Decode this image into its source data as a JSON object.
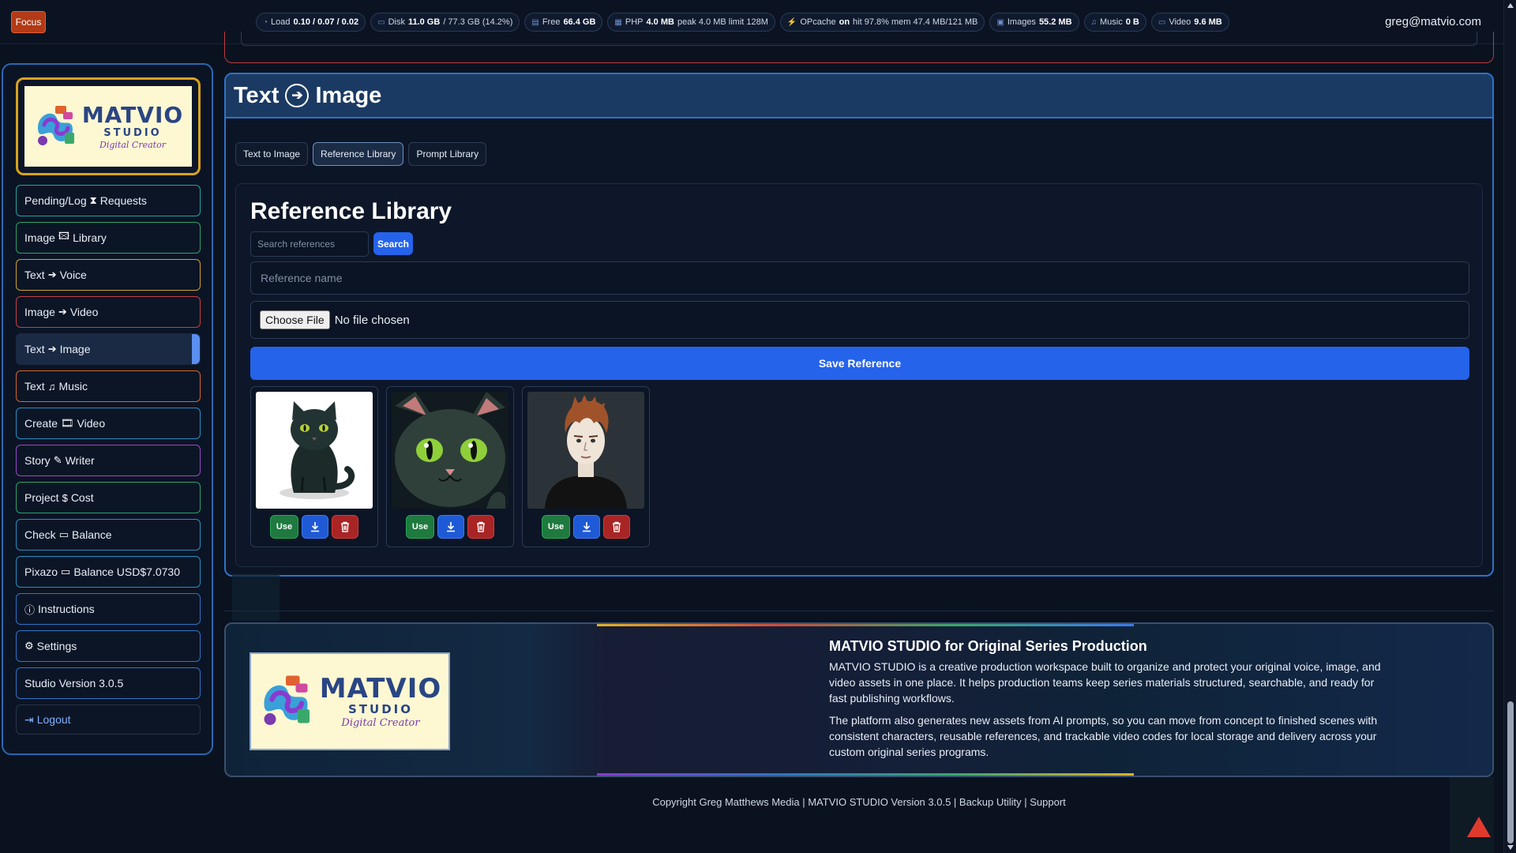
{
  "topbar": {
    "focus_label": "Focus",
    "stats": [
      {
        "icon": "gauge-icon",
        "label": "Load",
        "value": "0.10 / 0.07 / 0.02",
        "suffix": ""
      },
      {
        "icon": "disk-icon",
        "label": "Disk",
        "value": "11.0 GB",
        "suffix": "/ 77.3 GB (14.2%)"
      },
      {
        "icon": "database-icon",
        "label": "Free",
        "value": "66.4 GB",
        "suffix": ""
      },
      {
        "icon": "memory-icon",
        "label": "PHP",
        "value": "4.0 MB",
        "suffix": "peak 4.0 MB limit 128M"
      },
      {
        "icon": "lightning-icon",
        "label": "OPcache",
        "value": "on",
        "suffix": "hit 97.8% mem 47.4 MB/121 MB"
      },
      {
        "icon": "image-icon",
        "label": "Images",
        "value": "55.2 MB",
        "suffix": ""
      },
      {
        "icon": "music-icon",
        "label": "Music",
        "value": "0 B",
        "suffix": ""
      },
      {
        "icon": "video-icon",
        "label": "Video",
        "value": "9.6 MB",
        "suffix": ""
      }
    ],
    "user_email": "greg@matvio.com"
  },
  "brand": {
    "line1": "MATVIO",
    "line2": "STUDIO",
    "line3": "Digital Creator"
  },
  "sidebar": {
    "items": [
      {
        "label_a": "Pending/Log",
        "icon": "⧗",
        "label_b": "Requests",
        "color": "c-teal"
      },
      {
        "label_a": "Image",
        "icon": "🖾",
        "label_b": "Library",
        "color": "c-green"
      },
      {
        "label_a": "Text",
        "icon": "➔",
        "label_b": "Voice",
        "color": "c-yellow"
      },
      {
        "label_a": "Image",
        "icon": "➔",
        "label_b": "Video",
        "color": "c-red"
      },
      {
        "label_a": "Text",
        "icon": "➔",
        "label_b": "Image",
        "color": "c-blue"
      },
      {
        "label_a": "Text",
        "icon": "♫",
        "label_b": "Music",
        "color": "c-orange"
      },
      {
        "label_a": "Create",
        "icon": "🎞",
        "label_b": "Video",
        "color": "c-cyan"
      },
      {
        "label_a": "Story",
        "icon": "✎",
        "label_b": "Writer",
        "color": "c-purple"
      },
      {
        "label_a": "Project",
        "icon": "$",
        "label_b": "Cost",
        "color": "c-green"
      },
      {
        "label_a": "Check",
        "icon": "▭",
        "label_b": "Balance",
        "color": "c-cyan"
      },
      {
        "label_a": "Pixazo",
        "icon": "▭",
        "label_b": "Balance USD$7.0730",
        "color": "c-cyan"
      },
      {
        "label_a": "",
        "icon": "ⓘ",
        "label_b": "Instructions",
        "color": "c-blue"
      },
      {
        "label_a": "",
        "icon": "⚙",
        "label_b": "Settings",
        "color": "c-blue"
      },
      {
        "label_a": "Studio Version 3.0.5",
        "icon": "",
        "label_b": "",
        "color": "c-blue"
      }
    ],
    "logout_label": "Logout"
  },
  "panel": {
    "title_a": "Text",
    "title_b": "Image",
    "tabs": [
      "Text to Image",
      "Reference Library",
      "Prompt Library"
    ],
    "active_tab": 1
  },
  "library": {
    "title": "Reference Library",
    "search_placeholder": "Search references",
    "search_button": "Search",
    "name_placeholder": "Reference name",
    "choose_file_label": "Choose File",
    "no_file_text": "No file chosen",
    "save_button": "Save Reference",
    "references": [
      {
        "kind": "cat-sitting",
        "use_label": "Use"
      },
      {
        "kind": "cat-face",
        "use_label": "Use"
      },
      {
        "kind": "man-portrait",
        "use_label": "Use"
      }
    ]
  },
  "about": {
    "title": "MATVIO STUDIO for Original Series Production",
    "p1": "MATVIO STUDIO is a creative production workspace built to organize and protect your original voice, image, and video assets in one place. It helps production teams keep series materials structured, searchable, and ready for fast publishing workflows.",
    "p2": "The platform also generates new assets from AI prompts, so you can move from concept to finished scenes with consistent characters, reusable references, and trackable video codes for local storage and delivery across your custom original series programs."
  },
  "footer": {
    "copyright": "Copyright Greg Matthews Media | MATVIO STUDIO Version 3.0.5 | Backup Utility | Support"
  },
  "colors": {
    "accent": "#2563eb",
    "use_green": "#1e7a3e",
    "delete_red": "#a92424",
    "focus_orange": "#b23a16"
  }
}
